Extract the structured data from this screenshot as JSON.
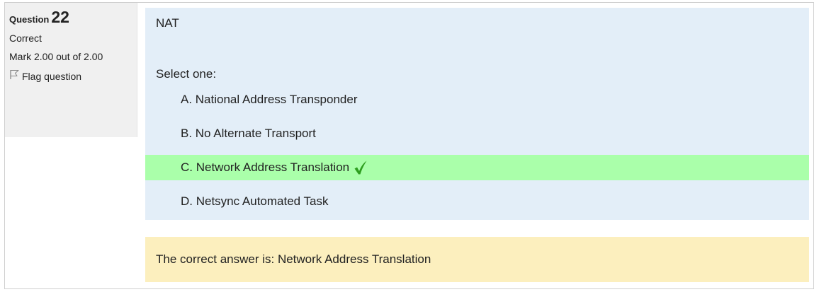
{
  "question": {
    "label": "Question",
    "number": "22",
    "state": "Correct",
    "grade": "Mark 2.00 out of 2.00",
    "flag_label": "Flag question",
    "text": "NAT",
    "prompt": "Select one:",
    "options": [
      {
        "label": "A. National Address Transponder"
      },
      {
        "label": "B. No Alternate Transport"
      },
      {
        "label": "C. Network Address Translation"
      },
      {
        "label": "D. Netsync Automated Task"
      }
    ],
    "right_answer": "The correct answer is: Network Address Translation"
  },
  "colors": {
    "info_bg": "#f0f0f0",
    "formulation_bg": "#e3eef8",
    "correct_bg": "#aaffaa",
    "feedback_bg": "#fcefbe",
    "check_green": "#2e9e1f"
  },
  "icons": {
    "flag": "flag-icon",
    "correct": "check-icon"
  }
}
